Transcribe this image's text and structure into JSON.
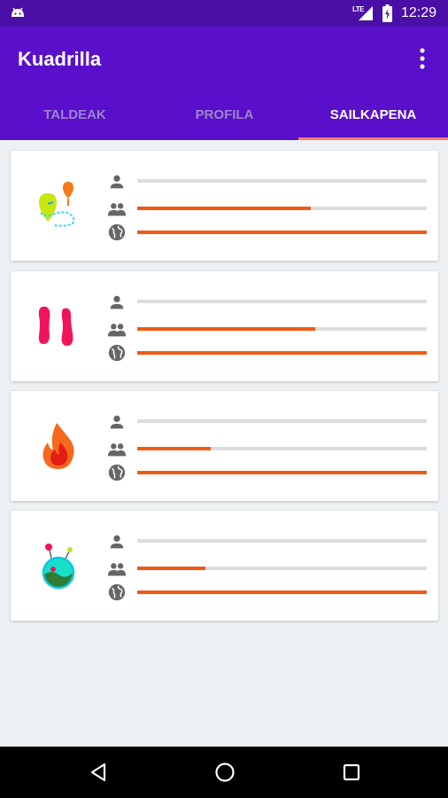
{
  "status_bar": {
    "network_label": "LTE",
    "time": "12:29",
    "icons": [
      "android-icon",
      "signal-icon",
      "battery-icon"
    ]
  },
  "app_bar": {
    "title": "Kuadrilla",
    "menu_icon": "more-vert-icon"
  },
  "tabs": [
    {
      "label": "TALDEAK",
      "selected": false
    },
    {
      "label": "PROFILA",
      "selected": false
    },
    {
      "label": "SAILKAPENA",
      "selected": true
    }
  ],
  "colors": {
    "status_bar": "#4a0fa6",
    "app_bar": "#5a0fca",
    "tab_indicator": "#ff7a6b",
    "progress_fill": "#f15a16",
    "progress_track": "#dcdcdc",
    "background": "#eef1f3"
  },
  "ranking_cards": [
    {
      "badge_icon": "map-route-icon",
      "levels": {
        "personal": 0.0,
        "group": 0.6,
        "global": 1.0
      }
    },
    {
      "badge_icon": "footprints-icon",
      "levels": {
        "personal": 0.0,
        "group": 0.615,
        "global": 1.0
      }
    },
    {
      "badge_icon": "flame-icon",
      "levels": {
        "personal": 0.0,
        "group": 0.255,
        "global": 1.0
      }
    },
    {
      "badge_icon": "planet-icon",
      "levels": {
        "personal": 0.0,
        "group": 0.235,
        "global": 1.0
      }
    }
  ],
  "row_icons": [
    "person-icon",
    "group-icon",
    "globe-icon"
  ],
  "nav_bar": {
    "buttons": [
      "back-icon",
      "home-icon",
      "recents-icon"
    ]
  }
}
